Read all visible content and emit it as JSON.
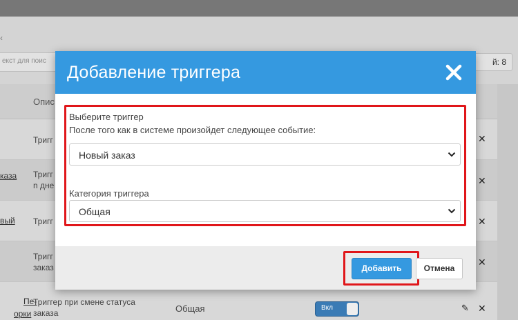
{
  "background": {
    "search_placeholder": "екст для поис",
    "count_text": "й: 8",
    "table": {
      "desc_header": "Опис",
      "rows": [
        {
          "name": "",
          "desc": "Тригг",
          "desc2": ""
        },
        {
          "name": "каза",
          "desc": "Тригг",
          "desc2": "n дне"
        },
        {
          "name": "вый",
          "desc": "Тригг",
          "desc2": ""
        },
        {
          "name": "",
          "desc": "Тригг",
          "desc2": "заказ"
        },
        {
          "name": "Пе-",
          "name2": "орки",
          "desc": "Триггер при смене статуса",
          "desc2": "заказа",
          "category": "Общая",
          "toggle_label": "Вкл"
        }
      ]
    }
  },
  "modal": {
    "title": "Добавление триггера",
    "trigger_label": "Выберите триггер",
    "trigger_hint": "После того как в системе произойдет следующее событие:",
    "trigger_select": {
      "value": "Новый заказ"
    },
    "category_label": "Категория триггера",
    "category_select": {
      "value": "Общая"
    },
    "add_button": "Добавить",
    "cancel_button": "Отмена"
  },
  "colors": {
    "header_blue": "#3599e0",
    "highlight_red": "#e0161a"
  },
  "icons": {
    "close": "close-icon",
    "dropdown": "chevron-down-icon",
    "edit": "pencil-icon",
    "delete": "x-icon"
  }
}
